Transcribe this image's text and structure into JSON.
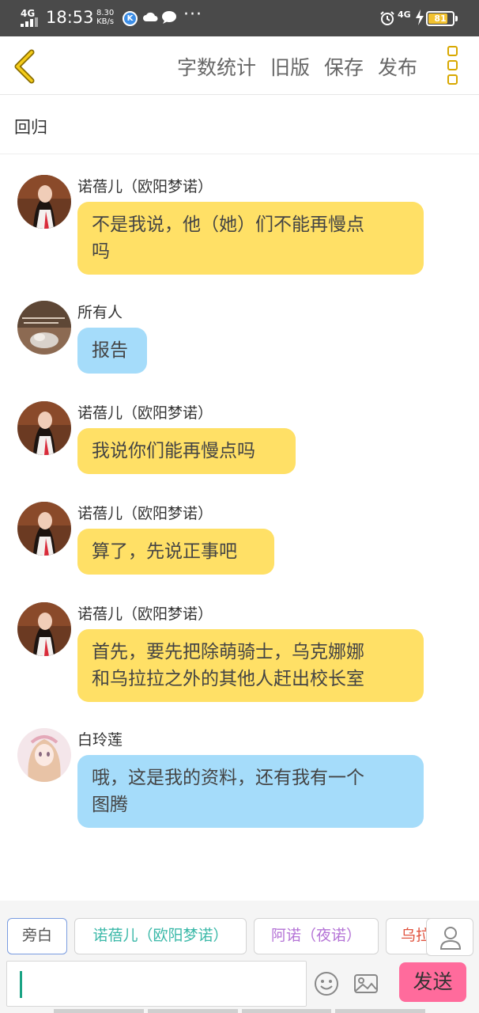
{
  "status_bar": {
    "network_left": "4G",
    "time": "18:53",
    "speed_value": "8.30",
    "speed_unit": "KB/s",
    "k_badge": "K",
    "dots": "···",
    "network_right": "4G",
    "battery": "81",
    "battery_level": 0.81
  },
  "toolbar": {
    "word_count": "字数统计",
    "old_version": "旧版",
    "save": "保存",
    "publish": "发布"
  },
  "chapter": {
    "title": "回归"
  },
  "messages": [
    {
      "name": "诺蓓儿（欧阳梦诺）",
      "text": "不是我说，他（她）们不能再慢点\n吗",
      "color": "yellow",
      "avatar": "nuobeier-avatar"
    },
    {
      "name": "所有人",
      "text": "报告",
      "color": "blue",
      "avatar": "group-avatar"
    },
    {
      "name": "诺蓓儿（欧阳梦诺）",
      "text": "我说你们能再慢点吗",
      "color": "yellow",
      "avatar": "nuobeier-avatar"
    },
    {
      "name": "诺蓓儿（欧阳梦诺）",
      "text": "算了，先说正事吧",
      "color": "yellow",
      "avatar": "nuobeier-avatar"
    },
    {
      "name": "诺蓓儿（欧阳梦诺）",
      "text": "首先，要先把除萌骑士，乌克娜娜\n和乌拉拉之外的其他人赶出校长室",
      "color": "yellow",
      "avatar": "nuobeier-avatar"
    },
    {
      "name": "白玲莲",
      "text": "哦，这是我的资料，还有我有一个\n图腾",
      "color": "blue",
      "avatar": "bailinglian-avatar"
    }
  ],
  "roles": [
    {
      "label": "旁白",
      "color": "#555555"
    },
    {
      "label": "诺蓓儿（欧阳梦诺）",
      "color": "#3ab8a8"
    },
    {
      "label": "阿诺（夜诺）",
      "color": "#b473d6"
    },
    {
      "label": "乌拉",
      "color": "#e0533f"
    }
  ],
  "composer": {
    "value": "",
    "send_label": "发送"
  },
  "colors": {
    "bubble_yellow": "#ffe066",
    "bubble_blue": "#a5dcfa",
    "send_button": "#ff6b9c",
    "accent": "#d8a800"
  }
}
